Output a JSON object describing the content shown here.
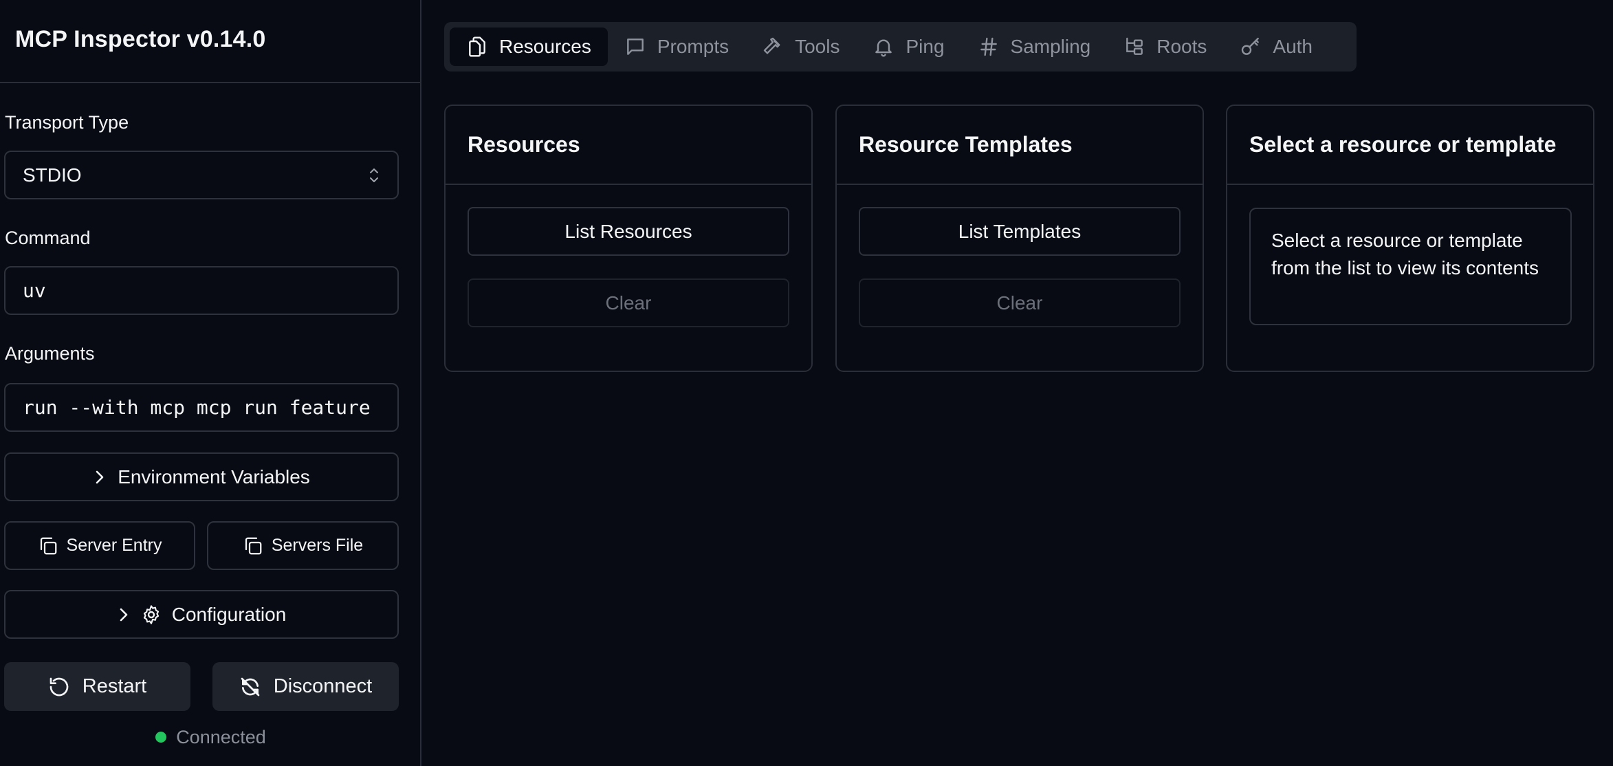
{
  "app": {
    "title": "MCP Inspector v0.14.0"
  },
  "sidebar": {
    "transport": {
      "label": "Transport Type",
      "value": "STDIO"
    },
    "command": {
      "label": "Command",
      "value": "uv"
    },
    "arguments": {
      "label": "Arguments",
      "value": "run --with mcp mcp run feature"
    },
    "env_vars_label": "Environment Variables",
    "server_entry_label": "Server Entry",
    "servers_file_label": "Servers File",
    "configuration_label": "Configuration",
    "restart_label": "Restart",
    "disconnect_label": "Disconnect",
    "status": {
      "text": "Connected",
      "color": "#22c55e"
    }
  },
  "tabs": [
    {
      "label": "Resources",
      "icon": "files-icon",
      "active": true
    },
    {
      "label": "Prompts",
      "icon": "message-square-icon",
      "active": false
    },
    {
      "label": "Tools",
      "icon": "hammer-icon",
      "active": false
    },
    {
      "label": "Ping",
      "icon": "bell-icon",
      "active": false
    },
    {
      "label": "Sampling",
      "icon": "hash-icon",
      "active": false
    },
    {
      "label": "Roots",
      "icon": "folder-tree-icon",
      "active": false
    },
    {
      "label": "Auth",
      "icon": "key-icon",
      "active": false
    }
  ],
  "cards": {
    "resources": {
      "title": "Resources",
      "list_label": "List Resources",
      "clear_label": "Clear"
    },
    "templates": {
      "title": "Resource Templates",
      "list_label": "List Templates",
      "clear_label": "Clear"
    },
    "detail": {
      "title": "Select a resource or template",
      "message": "Select a resource or template from the list to view its contents"
    }
  }
}
